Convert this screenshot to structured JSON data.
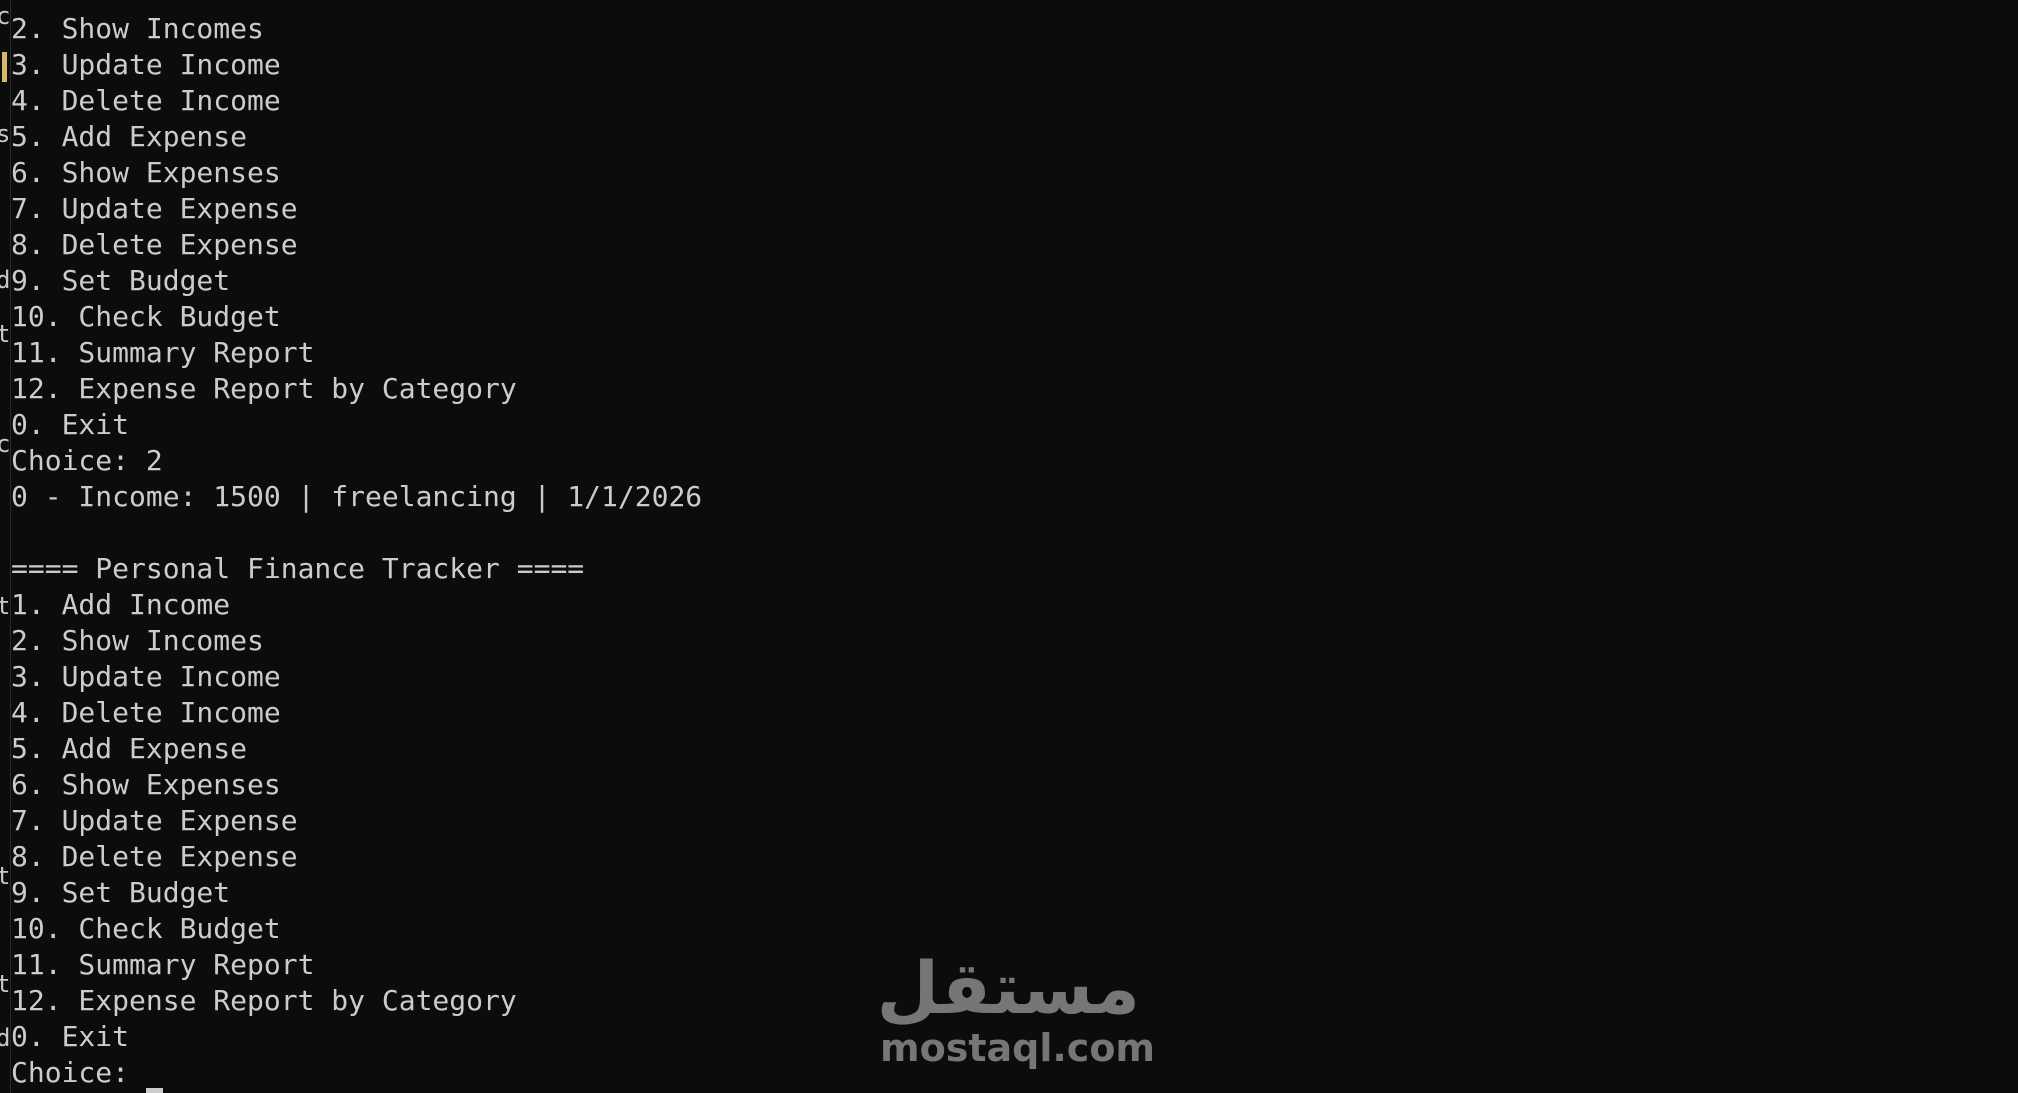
{
  "terminal": {
    "lines": [
      "2. Show Incomes",
      "3. Update Income",
      "4. Delete Income",
      "5. Add Expense",
      "6. Show Expenses",
      "7. Update Expense",
      "8. Delete Expense",
      "9. Set Budget",
      "10. Check Budget",
      "11. Summary Report",
      "12. Expense Report by Category",
      "0. Exit",
      "Choice: 2",
      "0 - Income: 1500 | freelancing | 1/1/2026",
      "",
      "==== Personal Finance Tracker ====",
      "1. Add Income",
      "2. Show Incomes",
      "3. Update Income",
      "4. Delete Income",
      "5. Add Expense",
      "6. Show Expenses",
      "7. Update Expense",
      "8. Delete Expense",
      "9. Set Budget",
      "10. Check Budget",
      "11. Summary Report",
      "12. Expense Report by Category",
      "0. Exit"
    ],
    "prompt": "Choice: "
  },
  "left_edge": {
    "chars": [
      "c",
      "s",
      "d",
      "t",
      "c",
      "t",
      "t",
      "t",
      "d"
    ]
  },
  "watermark": {
    "arabic": "مستقل",
    "latin": "mostaql.com"
  },
  "colors": {
    "background": "#0c0c0c",
    "foreground": "#cccccc"
  }
}
